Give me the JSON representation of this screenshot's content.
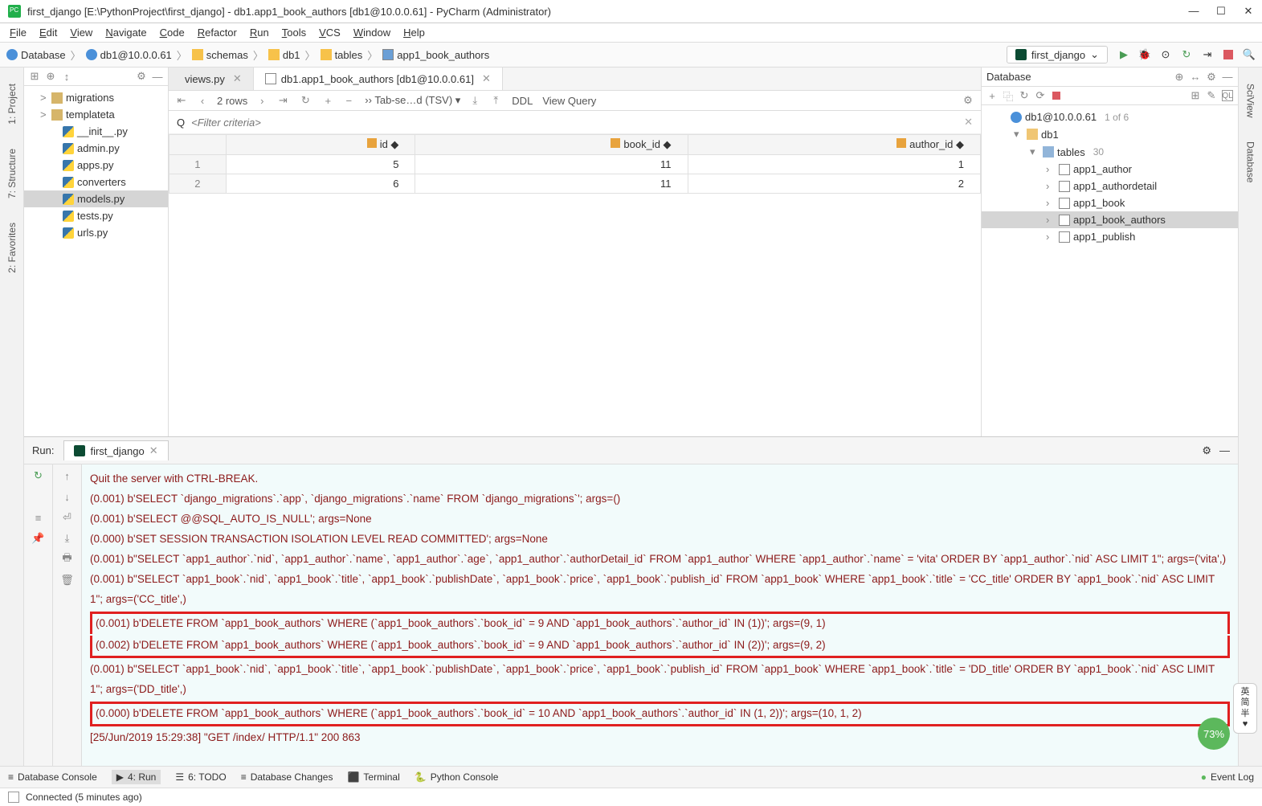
{
  "window": {
    "title": "first_django [E:\\PythonProject\\first_django] - db1.app1_book_authors [db1@10.0.0.61] - PyCharm (Administrator)"
  },
  "menubar": [
    "File",
    "Edit",
    "View",
    "Navigate",
    "Code",
    "Refactor",
    "Run",
    "Tools",
    "VCS",
    "Window",
    "Help"
  ],
  "breadcrumb": {
    "items": [
      {
        "label": "Database",
        "icon": "database"
      },
      {
        "label": "db1@10.0.0.61",
        "icon": "conn"
      },
      {
        "label": "schemas",
        "icon": "folder"
      },
      {
        "label": "db1",
        "icon": "schema"
      },
      {
        "label": "tables",
        "icon": "folder"
      },
      {
        "label": "app1_book_authors",
        "icon": "table"
      }
    ]
  },
  "run_config": {
    "label": "first_django"
  },
  "left_tabs": [
    "1: Project",
    "7: Structure",
    "2: Favorites"
  ],
  "right_tabs": [
    "SciView",
    "Database"
  ],
  "project_tree": [
    {
      "label": "migrations",
      "icon": "folder",
      "chev": ">"
    },
    {
      "label": "templateta",
      "icon": "folder",
      "chev": ">"
    },
    {
      "label": "__init__.py",
      "icon": "py",
      "indent": 1
    },
    {
      "label": "admin.py",
      "icon": "py",
      "indent": 1
    },
    {
      "label": "apps.py",
      "icon": "py",
      "indent": 1
    },
    {
      "label": "converters",
      "icon": "py",
      "indent": 1
    },
    {
      "label": "models.py",
      "icon": "py",
      "indent": 1,
      "sel": true
    },
    {
      "label": "tests.py",
      "icon": "py",
      "indent": 1
    },
    {
      "label": "urls.py",
      "icon": "py",
      "indent": 1
    }
  ],
  "editor_tabs": [
    {
      "label": "views.py",
      "icon": "py",
      "active": false
    },
    {
      "label": "db1.app1_book_authors [db1@10.0.0.61]",
      "icon": "table",
      "active": true
    }
  ],
  "table_toolbar": {
    "rows_label": "2 rows",
    "tx_label": "Tab-se…d (TSV)",
    "ddl": "DDL",
    "view_query": "View Query"
  },
  "filter": {
    "placeholder": "<Filter criteria>",
    "search_glyph": "Q"
  },
  "table": {
    "columns": [
      "id",
      "book_id",
      "author_id"
    ],
    "rows": [
      {
        "n": "1",
        "id": "5",
        "book_id": "11",
        "author_id": "1"
      },
      {
        "n": "2",
        "id": "6",
        "book_id": "11",
        "author_id": "2"
      }
    ]
  },
  "db_panel": {
    "title": "Database",
    "nodes": [
      {
        "indent": 0,
        "chev": "",
        "icon": "conn",
        "label": "db1@10.0.0.61",
        "meta": "1 of 6"
      },
      {
        "indent": 1,
        "chev": "▾",
        "icon": "schema",
        "label": "db1"
      },
      {
        "indent": 2,
        "chev": "▾",
        "icon": "folder2",
        "label": "tables",
        "meta": "30"
      },
      {
        "indent": 3,
        "chev": "›",
        "icon": "tbl",
        "label": "app1_author"
      },
      {
        "indent": 3,
        "chev": "›",
        "icon": "tbl",
        "label": "app1_authordetail"
      },
      {
        "indent": 3,
        "chev": "›",
        "icon": "tbl",
        "label": "app1_book"
      },
      {
        "indent": 3,
        "chev": "›",
        "icon": "tbl",
        "label": "app1_book_authors",
        "sel": true
      },
      {
        "indent": 3,
        "chev": "›",
        "icon": "tbl",
        "label": "app1_publish"
      }
    ]
  },
  "run_panel": {
    "label": "Run:",
    "tab": "first_django",
    "lines": [
      {
        "t": "Quit the server with CTRL-BREAK."
      },
      {
        "t": "(0.001) b'SELECT `django_migrations`.`app`, `django_migrations`.`name` FROM `django_migrations`'; args=()"
      },
      {
        "t": "(0.001) b'SELECT @@SQL_AUTO_IS_NULL'; args=None"
      },
      {
        "t": "(0.000) b'SET SESSION TRANSACTION ISOLATION LEVEL READ COMMITTED'; args=None"
      },
      {
        "t": "(0.001) b\"SELECT `app1_author`.`nid`, `app1_author`.`name`, `app1_author`.`age`, `app1_author`.`authorDetail_id` FROM `app1_author` WHERE `app1_author`.`name` = 'vita' ORDER BY `app1_author`.`nid` ASC LIMIT 1\"; args=('vita',)"
      },
      {
        "t": "(0.001) b\"SELECT `app1_book`.`nid`, `app1_book`.`title`, `app1_book`.`publishDate`, `app1_book`.`price`, `app1_book`.`publish_id` FROM `app1_book` WHERE `app1_book`.`title` = 'CC_title' ORDER BY `app1_book`.`nid` ASC LIMIT 1\"; args=('CC_title',)"
      },
      {
        "t": "(0.001) b'DELETE FROM `app1_book_authors` WHERE (`app1_book_authors`.`book_id` = 9 AND `app1_book_authors`.`author_id` IN (1))'; args=(9, 1)",
        "hl": "1a"
      },
      {
        "t": "(0.002) b'DELETE FROM `app1_book_authors` WHERE (`app1_book_authors`.`book_id` = 9 AND `app1_book_authors`.`author_id` IN (2))'; args=(9, 2)",
        "hl": "1b"
      },
      {
        "t": "(0.001) b\"SELECT `app1_book`.`nid`, `app1_book`.`title`, `app1_book`.`publishDate`, `app1_book`.`price`, `app1_book`.`publish_id` FROM `app1_book` WHERE `app1_book`.`title` = 'DD_title' ORDER BY `app1_book`.`nid` ASC LIMIT 1\"; args=('DD_title',)"
      },
      {
        "t": "(0.000) b'DELETE FROM `app1_book_authors` WHERE (`app1_book_authors`.`book_id` = 10 AND `app1_book_authors`.`author_id` IN (1, 2))'; args=(10, 1, 2)",
        "hl": "2"
      },
      {
        "t": "[25/Jun/2019 15:29:38] \"GET /index/ HTTP/1.1\" 200 863"
      }
    ]
  },
  "bottom_tabs": [
    {
      "label": "Database Console",
      "icon": "db"
    },
    {
      "label": "4: Run",
      "icon": "play",
      "active": true
    },
    {
      "label": "6: TODO",
      "icon": "list"
    },
    {
      "label": "Database Changes",
      "icon": "db"
    },
    {
      "label": "Terminal",
      "icon": "term"
    },
    {
      "label": "Python Console",
      "icon": "py"
    }
  ],
  "event_log": "Event Log",
  "status": "Connected (5 minutes ago)",
  "pct_badge": "73%",
  "ime": "英\n简\n半"
}
